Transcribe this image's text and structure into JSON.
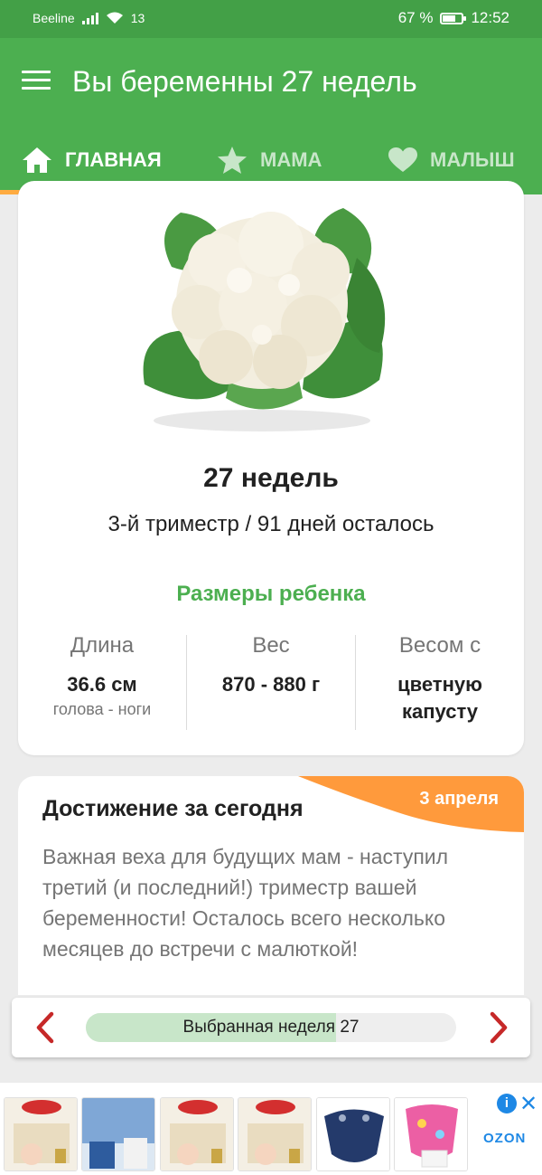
{
  "status_bar": {
    "carrier": "Beeline",
    "wifi_speed": "13",
    "battery": "67 %",
    "time": "12:52"
  },
  "app_bar": {
    "title": "Вы беременны 27 недель",
    "menu_icon": "hamburger-icon"
  },
  "tabs": [
    {
      "label": "ГЛАВНАЯ",
      "icon": "home-icon",
      "active": true
    },
    {
      "label": "МАМА",
      "icon": "star-icon",
      "active": false
    },
    {
      "label": "МАЛЫШ",
      "icon": "heart-icon",
      "active": false
    }
  ],
  "week_card": {
    "image": "cauliflower",
    "title": "27 недель",
    "subtitle": "3-й триместр / 91 дней осталось",
    "sizes_title": "Размеры ребенка",
    "sizes": [
      {
        "label": "Длина",
        "value": "36.6 см",
        "note": "голова - ноги"
      },
      {
        "label": "Вес",
        "value": "870 - 880 г",
        "note": ""
      },
      {
        "label": "Весом с",
        "value": "цветную капусту",
        "note": ""
      }
    ]
  },
  "achievement": {
    "title": "Достижение за сегодня",
    "date": "3 апреля",
    "text": "Важная веха для будущих мам - наступил третий (и последний!) триместр вашей беременности! Осталось всего несколько месяцев до встречи с малюткой!"
  },
  "week_selector": {
    "label": "Выбранная неделя 27",
    "progress": 0.675,
    "prev_icon": "chevron-left-icon",
    "next_icon": "chevron-right-icon"
  },
  "ad": {
    "brand": "OZON",
    "info_icon": "info-icon",
    "close_icon": "close-icon",
    "items": [
      "Huggies Elite Soft",
      "Veronese",
      "Huggies Elite Soft",
      "Huggies Elite Soft",
      "Cloth diaper",
      "Diaper"
    ]
  },
  "colors": {
    "primary": "#4caf50",
    "status_bar": "#43a047",
    "accent": "#ffab40",
    "badge": "#ff9a3c",
    "arrow": "#c62828"
  }
}
